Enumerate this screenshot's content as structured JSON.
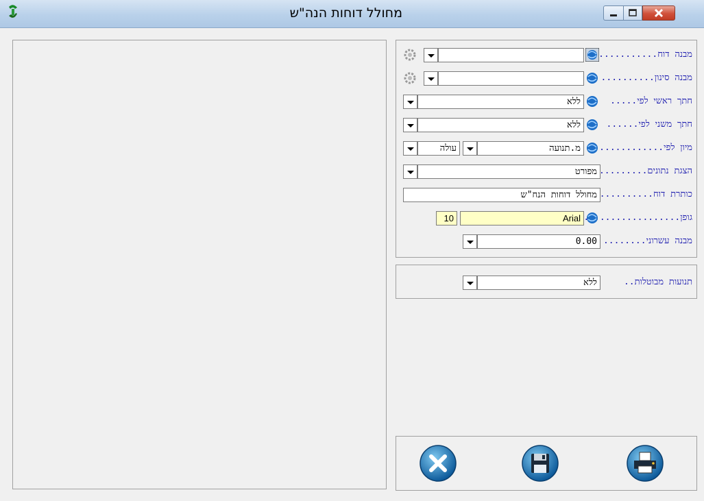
{
  "window": {
    "title": "מחולל דוחות הנה\"ש"
  },
  "settings": {
    "report_structure": {
      "label": "מבנה דוח.............",
      "value": ""
    },
    "filter_structure": {
      "label": "מבנה סינון..........",
      "value": ""
    },
    "main_cut": {
      "label": "חתך ראשי לפי.....",
      "value": "ללא"
    },
    "secondary_cut": {
      "label": "חתך משני לפי......",
      "value": "ללא"
    },
    "sort": {
      "label": "מיון לפי..............",
      "value": "מ.תנועה",
      "order": "עולה"
    },
    "data_display": {
      "label": "הצגת נתונים.........",
      "value": "מפורט"
    },
    "report_title": {
      "label": "כותרת דוח............",
      "value": "מחולל דוחות הנח\"ש"
    },
    "font": {
      "label": "גופן.......................",
      "value": "Arial",
      "size": "10"
    },
    "decimal_format": {
      "label": "מבנה עשרוני........",
      "value": "0.00"
    }
  },
  "cancelled": {
    "label": "תנועות מבוטלות..",
    "value": "ללא"
  },
  "icons": {
    "app": "app-logo-icon",
    "globe": "globe-icon",
    "gear": "gear-icon",
    "exit": "exit-icon",
    "save": "save-icon",
    "print": "print-icon"
  }
}
